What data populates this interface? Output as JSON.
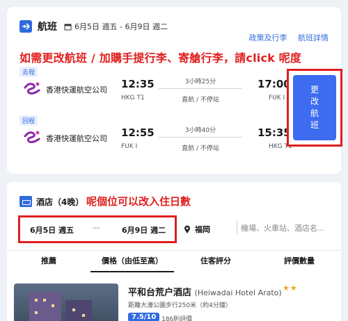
{
  "flight_section": {
    "title": "航班",
    "dates": "6月5日 週五 - 6月9日 週二",
    "links": [
      "政策及行李",
      "航班詳情"
    ],
    "annotation": "如需更改航班 / 加購手提行李、寄艙行李，請click 呢度",
    "legs": [
      {
        "tag": "去程",
        "airline": "香港快運航空公司",
        "dep_time": "12:35",
        "dep_airport": "HKG T1",
        "duration": "3小時25分",
        "stops": "直航 / 不停站",
        "arr_time": "17:00",
        "arr_airport": "FUK I"
      },
      {
        "tag": "回程",
        "airline": "香港快運航空公司",
        "dep_time": "12:55",
        "dep_airport": "FUK I",
        "duration": "3小時40分",
        "stops": "直航 / 不停站",
        "arr_time": "15:35",
        "arr_airport": "HKG T1"
      }
    ],
    "change_button": [
      "更",
      "改",
      "航",
      "班"
    ]
  },
  "hotel_section": {
    "title": "酒店（4晚）",
    "annotation": "呢個位可以改入住日數",
    "checkin": "6月5日 週五",
    "dash": "—",
    "checkout": "6月9日 週二",
    "city": "福岡",
    "search_placeholder": "機場、火車站、酒店名...",
    "sort_tabs": [
      "推薦",
      "價格（由低至高）",
      "住客評分",
      "評價數量"
    ],
    "hotel": {
      "name": "平和台荒户酒店",
      "name_en": "(Heiwadai Hotel Arato)",
      "stars": "★★",
      "distance": "距離大濠公園步行250米（約4分鐘）",
      "rating": "7.5/10",
      "reviews": "186則評價"
    }
  },
  "colors": {
    "accent": "#2f6bdc",
    "button": "#3d6cf0",
    "annotation_red": "#e01f1f"
  }
}
